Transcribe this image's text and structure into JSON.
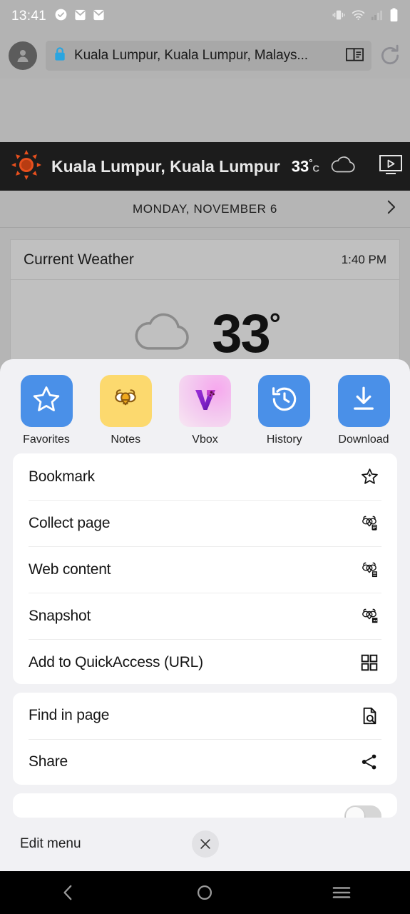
{
  "statusbar": {
    "time": "13:41",
    "icons_left": [
      "check-circle-icon",
      "mail-icon",
      "mail-icon"
    ],
    "icons_right": [
      "vibrate-icon",
      "wifi-icon",
      "signal-icon",
      "battery-icon"
    ]
  },
  "browser": {
    "avatar": "profile-avatar",
    "lock": "lock-icon",
    "url": "Kuala Lumpur, Kuala Lumpur, Malays...",
    "reader_icon": "reader-mode-icon",
    "reload_icon": "reload-icon"
  },
  "weather": {
    "sun_icon": "sun-icon",
    "location": "Kuala Lumpur, Kuala Lumpur",
    "temp": "33",
    "degree": "°",
    "unit": "C",
    "cloud_icon": "cloud-icon",
    "video_icon": "video-play-icon",
    "menu_icon": "hamburger-icon",
    "date": "MONDAY, NOVEMBER 6",
    "next_icon": "chevron-right-icon",
    "card_title": "Current Weather",
    "card_time": "1:40 PM",
    "big_temp": "33",
    "big_degree": "°"
  },
  "sheet": {
    "shortcuts": [
      {
        "label": "Favorites",
        "icon": "star-icon",
        "bg": "#4a90e8",
        "fg": "#ffffff"
      },
      {
        "label": "Notes",
        "icon": "bee-icon",
        "bg": "#fcd96e",
        "fg": "#8a6a10"
      },
      {
        "label": "Vbox",
        "icon": "vbox-logo-icon",
        "bg": "#f0b6e8",
        "fg": "#a020c0"
      },
      {
        "label": "History",
        "icon": "history-icon",
        "bg": "#4a90e8",
        "fg": "#ffffff"
      },
      {
        "label": "Download",
        "icon": "download-icon",
        "bg": "#4a90e8",
        "fg": "#ffffff"
      }
    ],
    "group1": [
      {
        "label": "Bookmark",
        "icon": "star-plus-icon"
      },
      {
        "label": "Collect page",
        "icon": "bee-collect-icon"
      },
      {
        "label": "Web content",
        "icon": "bee-list-icon"
      },
      {
        "label": "Snapshot",
        "icon": "bee-image-icon"
      },
      {
        "label": "Add to QuickAccess (URL)",
        "icon": "grid-icon"
      }
    ],
    "group2": [
      {
        "label": "Find in page",
        "icon": "find-in-page-icon"
      },
      {
        "label": "Share",
        "icon": "share-icon"
      }
    ],
    "group3": [
      {
        "label": "",
        "icon": "toggle-switch-off"
      }
    ],
    "footer": {
      "edit_menu": "Edit menu",
      "close_icon": "close-icon"
    }
  },
  "navbar": {
    "back": "back-icon",
    "home": "home-icon",
    "recents": "recents-icon"
  },
  "colors": {
    "accent_blue": "#4a90e8",
    "sheet_bg": "#f1f1f4",
    "card_bg": "#ffffff",
    "header_dark": "#1c1c1c"
  }
}
